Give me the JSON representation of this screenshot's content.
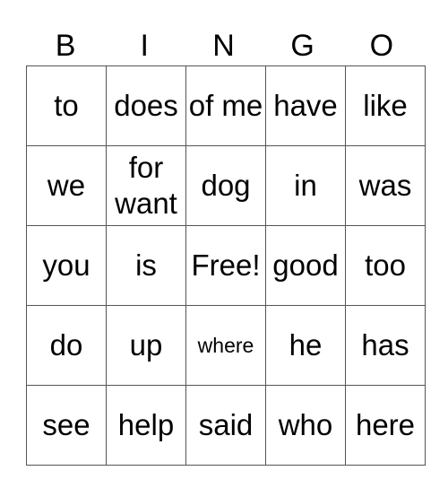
{
  "header": [
    "B",
    "I",
    "N",
    "G",
    "O"
  ],
  "rows": [
    [
      "to",
      "does",
      "of me",
      "have",
      "like"
    ],
    [
      "we",
      "for want",
      "dog",
      "in",
      "was"
    ],
    [
      "you",
      "is",
      "Free!",
      "good",
      "too"
    ],
    [
      "do",
      "up",
      "where",
      "he",
      "has"
    ],
    [
      "see",
      "help",
      "said",
      "who",
      "here"
    ]
  ]
}
